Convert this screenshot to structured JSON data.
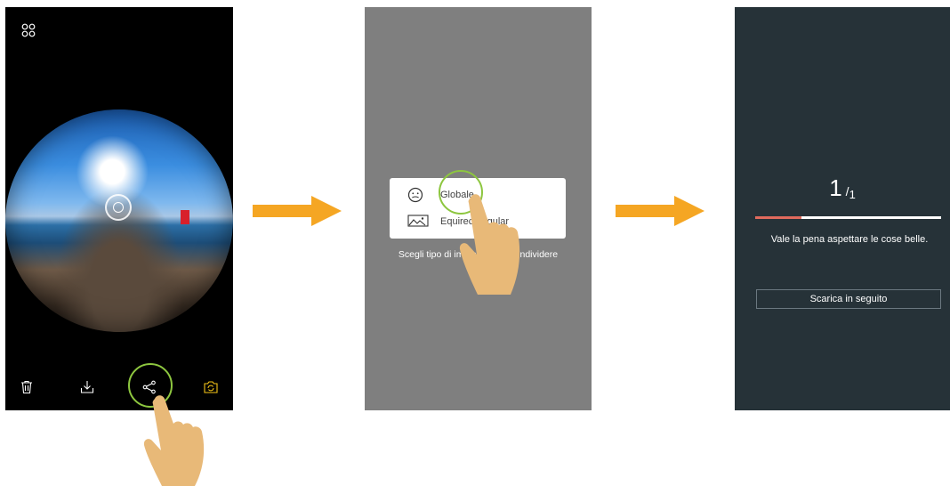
{
  "screen1": {
    "toolbar_icons": [
      "delete-icon",
      "download-icon",
      "share-icon",
      "camera-switch-icon"
    ]
  },
  "screen2": {
    "options": [
      {
        "label": "Globale",
        "icon": "globe-face-icon"
      },
      {
        "label": "Equirectangular",
        "icon": "landscape-icon"
      }
    ],
    "hint": "Scegli tipo di immagine da condividere"
  },
  "screen3": {
    "count_current": "1",
    "count_sep": "/",
    "count_total": "1",
    "progress": 0.25,
    "message": "Vale la pena aspettare le cose belle.",
    "later_button": "Scarica in seguito"
  },
  "colors": {
    "highlight": "#8dc63f",
    "arrow": "#f5a623",
    "hand": "#e8b978",
    "progress_fill": "#e06a5d",
    "screen3_bg": "#263238",
    "screen2_bg": "#7f7f7f"
  }
}
